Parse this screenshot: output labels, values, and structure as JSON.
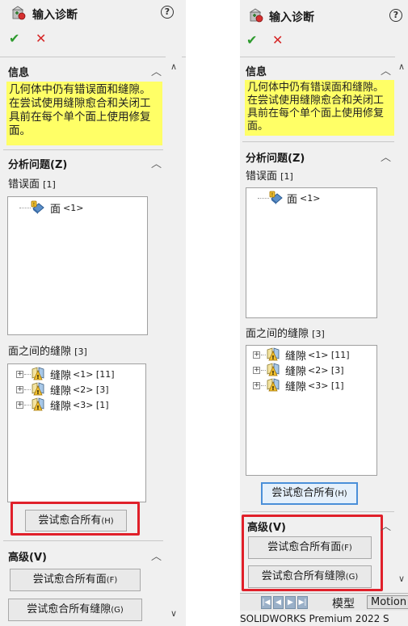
{
  "title": "输入诊断",
  "help_glyph": "?",
  "ok_glyph": "✔",
  "cancel_glyph": "✕",
  "info": {
    "heading": "信息",
    "message": "几何体中仍有错误面和缝隙。在尝试使用缝隙愈合和关闭工具前在每个单个面上使用修复面。"
  },
  "analyze": {
    "heading": "分析问题(Z)",
    "faulty_faces_label": "错误面",
    "faulty_faces_count": "[1]",
    "faulty_faces": [
      {
        "name": "面",
        "suffix": "<1>"
      }
    ],
    "gaps_label": "面之间的缝隙",
    "gaps_count": "[3]",
    "gaps": [
      {
        "name": "缝隙",
        "suffix": "<1> [11]"
      },
      {
        "name": "缝隙",
        "suffix": "<2> [3]"
      },
      {
        "name": "缝隙",
        "suffix": "<3> [1]"
      }
    ],
    "heal_all_label": "尝试愈合所有",
    "heal_all_hotkey": "(H)"
  },
  "advanced": {
    "heading": "高级(V)",
    "heal_all_faces_label": "尝试愈合所有面",
    "heal_all_faces_hotkey": "(F)",
    "heal_all_gaps_label": "尝试愈合所有缝隙",
    "heal_all_gaps_hotkey": "(G)"
  },
  "tabs": {
    "model": "模型",
    "motion": "Motion"
  },
  "status_text": "SOLIDWORKS Premium 2022 S",
  "colors": {
    "ok": "#2e9b2e",
    "cancel": "#d62626",
    "info_bg": "#ffff66",
    "highlight": "#e0202a"
  }
}
